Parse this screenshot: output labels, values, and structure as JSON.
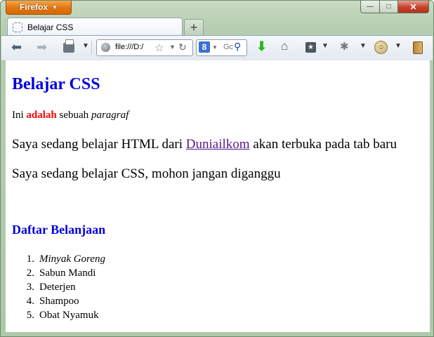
{
  "browser": {
    "menu_button": "Firefox",
    "tab_title": "Belajar CSS",
    "newtab_symbol": "+",
    "url": "file:///D:/",
    "search_engine_hint": "Gc",
    "controls": {
      "minimize": "—",
      "maximize": "□",
      "close": "✕"
    }
  },
  "page": {
    "heading": "Belajar CSS",
    "paragraph1": {
      "before": "Ini ",
      "highlight": "adalah",
      "middle": " sebuah ",
      "italic": "paragraf"
    },
    "paragraph2": {
      "before": "Saya sedang belajar HTML dari ",
      "link_text": "Duniailkom",
      "after": " akan terbuka pada tab baru"
    },
    "paragraph3": "Saya sedang belajar CSS, mohon jangan diganggu",
    "list_heading": "Daftar Belanjaan",
    "list": [
      {
        "num": "1.",
        "text": "Minyak Goreng"
      },
      {
        "num": "2.",
        "text": "Sabun Mandi"
      },
      {
        "num": "3.",
        "text": "Deterjen"
      },
      {
        "num": "4.",
        "text": "Shampoo"
      },
      {
        "num": "5.",
        "text": "Obat Nyamuk"
      }
    ]
  },
  "colors": {
    "heading": "#0000e0",
    "highlight": "#ff0000",
    "visited_link": "#551a8b",
    "firefox_button": "#e0750f"
  }
}
